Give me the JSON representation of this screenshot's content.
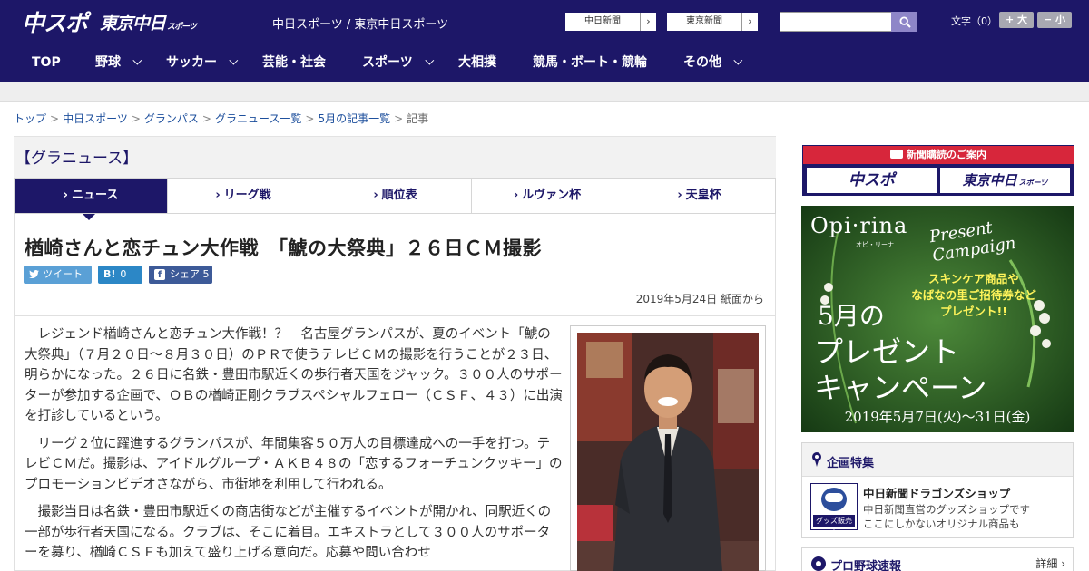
{
  "header": {
    "logo_main": "中スポ",
    "logo_tokyo": "東京中日",
    "logo_tokyo_sub": "スポーツ",
    "site_name": "中日スポーツ / 東京中日スポーツ",
    "ext_links": [
      {
        "label": "中日新聞",
        "arrow": "›"
      },
      {
        "label": "東京新聞",
        "arrow": "›"
      }
    ],
    "search_placeholder": "",
    "font_size_label": "文字（0）",
    "font_larger": "+ 大",
    "font_smaller": "− 小"
  },
  "nav": {
    "items": [
      {
        "label": "TOP"
      },
      {
        "label": "野球"
      },
      {
        "label": "サッカー"
      },
      {
        "label": "芸能・社会"
      },
      {
        "label": "スポーツ"
      },
      {
        "label": "大相撲"
      },
      {
        "label": "競馬・ボート・競輪"
      },
      {
        "label": "その他"
      }
    ]
  },
  "breadcrumb": {
    "items": [
      "トップ",
      "中日スポーツ",
      "グランパス",
      "グラニュース一覧",
      "5月の記事一覧"
    ],
    "current": "記事",
    "separator": ">"
  },
  "section": {
    "title": "【グラニュース】"
  },
  "tabs": [
    {
      "label": "ニュース",
      "active": true
    },
    {
      "label": "リーグ戦",
      "active": false
    },
    {
      "label": "順位表",
      "active": false
    },
    {
      "label": "ルヴァン杯",
      "active": false
    },
    {
      "label": "天皇杯",
      "active": false
    }
  ],
  "tab_marker": "›",
  "article": {
    "headline": "楢崎さんと恋チュン大作戦　「鯱の大祭典」２６日ＣＭ撮影",
    "share": {
      "tweet": "ツイート",
      "hatena_icon": "B!",
      "hatena_count": "0",
      "facebook_icon": "f",
      "facebook": "シェア 5"
    },
    "dateline": "2019年5月24日 紙面から",
    "paragraphs": [
      "レジェンド楢崎さんと恋チュン大作戦！？　名古屋グランパスが、夏のイベント「鯱の大祭典」（７月２０日～８月３０日）のＰＲで使うテレビＣＭの撮影を行うことが２３日、明らかになった。２６日に名鉄・豊田市駅近くの歩行者天国をジャック。３００人のサポーターが参加する企画で、ＯＢの楢崎正剛クラブスペシャルフェロー（ＣＳＦ、４３）に出演を打診しているという。",
      "リーグ２位に躍進するグランパスが、年間集客５０万人の目標達成への一手を打つ。テレビＣＭだ。撮影は、アイドルグループ・ＡＫＢ４８の「恋するフォーチュンクッキー」のプロモーションビデオさながら、市街地を利用して行われる。",
      "撮影当日は名鉄・豊田市駅近くの商店街などが主催するイベントが開かれ、同駅近くの一部が歩行者天国になる。クラブは、そこに着目。エキストラとして３００人のサポーターを募り、楢崎ＣＳＦも加えて盛り上げる意向だ。応募や問い合わせ"
    ]
  },
  "sidebar": {
    "subscribe_head": "新聞購読のご案内",
    "subscribe_logo_1": "中スポ",
    "subscribe_logo_2": "東京中日",
    "subscribe_logo_2_sub": "スポーツ",
    "ad": {
      "brand": "Opi·rina",
      "brand_sub": "オピ・リーナ",
      "campaign": "Present Campaign",
      "promo_line_1": "スキンケア商品や",
      "promo_line_2": "なばなの里ご招待券など",
      "promo_line_3": "プレゼント!!",
      "big_1": "5月の",
      "big_2": "プレゼント",
      "big_3": "キャンペーン",
      "date": "2019年5月7日(火)〜31日(金)"
    },
    "feature": {
      "title": "企画特集",
      "shop_title": "中日新聞ドラゴンズショップ",
      "shop_desc_1": "中日新聞直営のグッズショップです",
      "shop_desc_2": "ここにしかないオリジナル商品も",
      "shop_tag": "グッズ販売中"
    },
    "baseball": {
      "title": "プロ野球速報",
      "more": "詳細 ›"
    }
  },
  "colors": {
    "brand_navy": "#1d1768",
    "link_blue": "#1d4f9c",
    "subscribe_red": "#d7263b",
    "twitter": "#5aa0d6",
    "hatena": "#2c87c6",
    "facebook": "#3d5a98"
  }
}
